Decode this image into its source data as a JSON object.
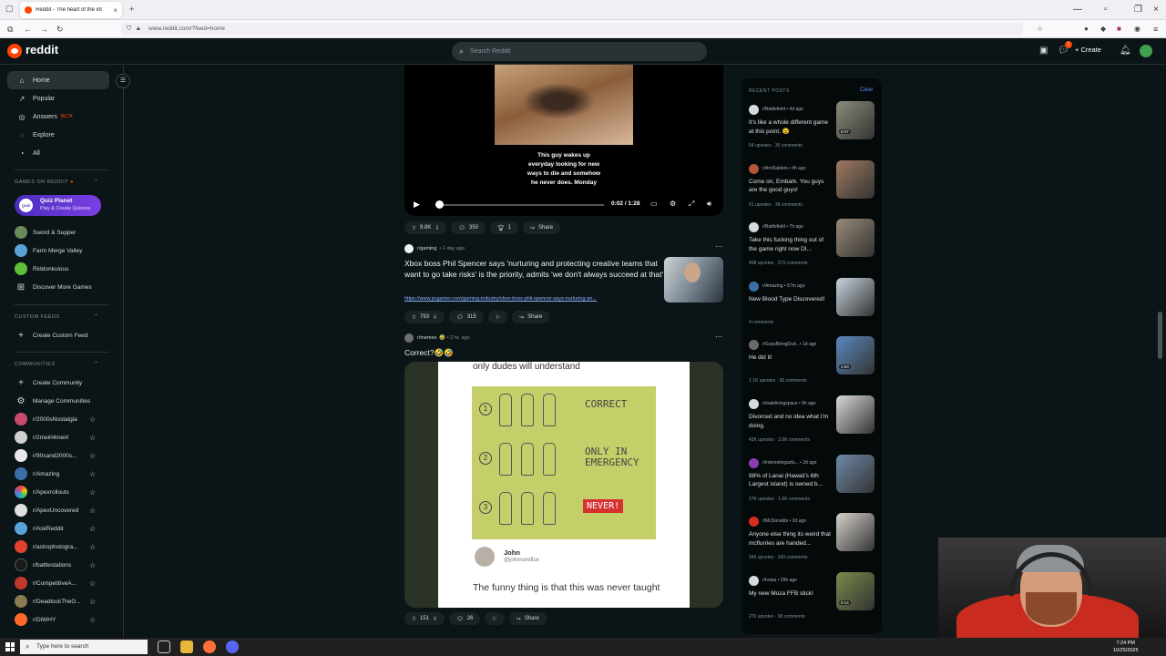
{
  "browser": {
    "tab_title": "Reddit - The heart of the int",
    "url": "www.reddit.com/?feed=home"
  },
  "header": {
    "logo_text": "reddit",
    "search_placeholder": "Search Reddit",
    "create_label": "Create",
    "notification_count": "1"
  },
  "sidebar": {
    "nav": [
      {
        "label": "Home",
        "icon": "home-icon"
      },
      {
        "label": "Popular",
        "icon": "popular-icon"
      },
      {
        "label": "Answers",
        "badge": "BETA",
        "icon": "answers-icon"
      },
      {
        "label": "Explore",
        "icon": "explore-icon"
      },
      {
        "label": "All",
        "icon": "all-icon"
      }
    ],
    "games_heading": "GAMES ON REDDIT",
    "featured_game": {
      "title": "Quiz Planet",
      "subtitle": "Play & Create Quizzes",
      "icon_text": "QUIZ"
    },
    "games": [
      "Sword & Supper",
      "Farm Merge Valley",
      "Riddonkulous",
      "Discover More Games"
    ],
    "custom_feeds_heading": "CUSTOM FEEDS",
    "create_custom_feed": "Create Custom Feed",
    "communities_heading": "COMMUNITIES",
    "create_community": "Create Community",
    "manage_communities": "Manage Communities",
    "communities": [
      "r/2000sNostalgia",
      "r/2meirl4meirl",
      "r/90sand2000s...",
      "r/Amazing",
      "r/Apexrollouts",
      "r/ApexUncovered",
      "r/AskReddit",
      "r/astrophotogra...",
      "r/battlestations",
      "r/CompetitiveA...",
      "r/DeadlockTheG...",
      "r/DiWHY"
    ]
  },
  "feed": {
    "video_post": {
      "caption": "This guy wakes up\neveryday looking for new\nways to die and somehow\nhe never does. Monday",
      "time": "0:02 / 1:28",
      "progress": 0.02,
      "votes": "9.8K",
      "comments": "350",
      "awards": "1",
      "share": "Share"
    },
    "xbox_post": {
      "subreddit": "r/gaming",
      "age": "1 day ago",
      "title": "Xbox boss Phil Spencer says 'nurturing and protecting creative teams that want to go take risks' is the priority, admits 'we don't always succeed at that'",
      "link": "https://www.pcgamer.com/gaming-industry/xbox-boss-phil-spencer-says-nurturing-an...",
      "votes": "793",
      "comments": "315",
      "share": "Share"
    },
    "meme_post": {
      "subreddit": "r/memes",
      "age": "2 hr. ago",
      "title": "Correct?🤣🤣",
      "meme_header": "only dudes will understand",
      "rows": [
        {
          "num": "1",
          "label": "CORRECT"
        },
        {
          "num": "2",
          "label": "ONLY IN\nEMERGENCY"
        },
        {
          "num": "3",
          "label": "NEVER!"
        }
      ],
      "tweet_name": "John",
      "tweet_handle": "@johnnorefice",
      "tweet_text": "The funny thing is that this was never taught",
      "votes": "151",
      "comments": "26",
      "share": "Share"
    }
  },
  "recent_posts": {
    "heading": "RECENT POSTS",
    "clear": "Clear",
    "items": [
      {
        "sub": "r/Battlefield • 4d ago",
        "title": "It's like a whole different game at this point. 😵",
        "stats": "54 upvotes · 36 comments",
        "duration": "0:47",
        "color": "#8a8c7a",
        "sub_color": "#d7dadc"
      },
      {
        "sub": "r/ArcRaiders • 4h ago",
        "title": "Come on, Embark. You guys are the good guys!",
        "stats": "61 upvotes · 38 comments",
        "color": "#a07a60",
        "sub_color": "#b4543a"
      },
      {
        "sub": "r/Battlefield • 7h ago",
        "title": "Take this fucking thing out of the game right now DI...",
        "stats": "408 upvotes · 273 comments",
        "color": "#9a8a78",
        "sub_color": "#d7dadc"
      },
      {
        "sub": "r/Amazing • 57m ago",
        "title": "New Blood Type Discovered!",
        "stats": "4 comments",
        "color": "#c7d4de",
        "sub_color": "#3a6ea5"
      },
      {
        "sub": "r/GuysBeingDud...• 1d ago",
        "title": "He did it!",
        "stats": "1.1K upvotes · 65 comments",
        "duration": "1:03",
        "color": "#5a8ac0",
        "sub_color": "#6a6a6a"
      },
      {
        "sub": "r/malelivingspace • 9h ago",
        "title": "Divorced and no idea what I'm doing.",
        "stats": "43K upvotes · 3.9K comments",
        "color": "#d9d9d9",
        "sub_color": "#d7dadc"
      },
      {
        "sub": "r/interestingasfu... • 2d ago",
        "title": "98% of Lanai (Hawaii's 6th Largest island) is owned b...",
        "stats": "27K upvotes · 1.6K comments",
        "color": "#6f8aa8",
        "sub_color": "#8a3fb0"
      },
      {
        "sub": "r/McDonalds • 2d ago",
        "title": "Anyone else thing its weird that mcflurries are handed...",
        "stats": "343 upvotes · 343 comments",
        "color": "#d6d2cc",
        "sub_color": "#d62d20"
      },
      {
        "sub": "r/hotas • 20h ago",
        "title": "My new Moza FFB stick!",
        "stats": "270 upvotes · 38 comments",
        "duration": "0:14",
        "color": "#7a8a4a",
        "sub_color": "#d7dadc"
      }
    ]
  },
  "taskbar": {
    "search_placeholder": "Type here to search",
    "time": "7:24 PM",
    "date": "10/25/2025"
  },
  "colors": {
    "accent": "#ff4500",
    "background": "#0b1416",
    "link": "#8bb5ff"
  }
}
